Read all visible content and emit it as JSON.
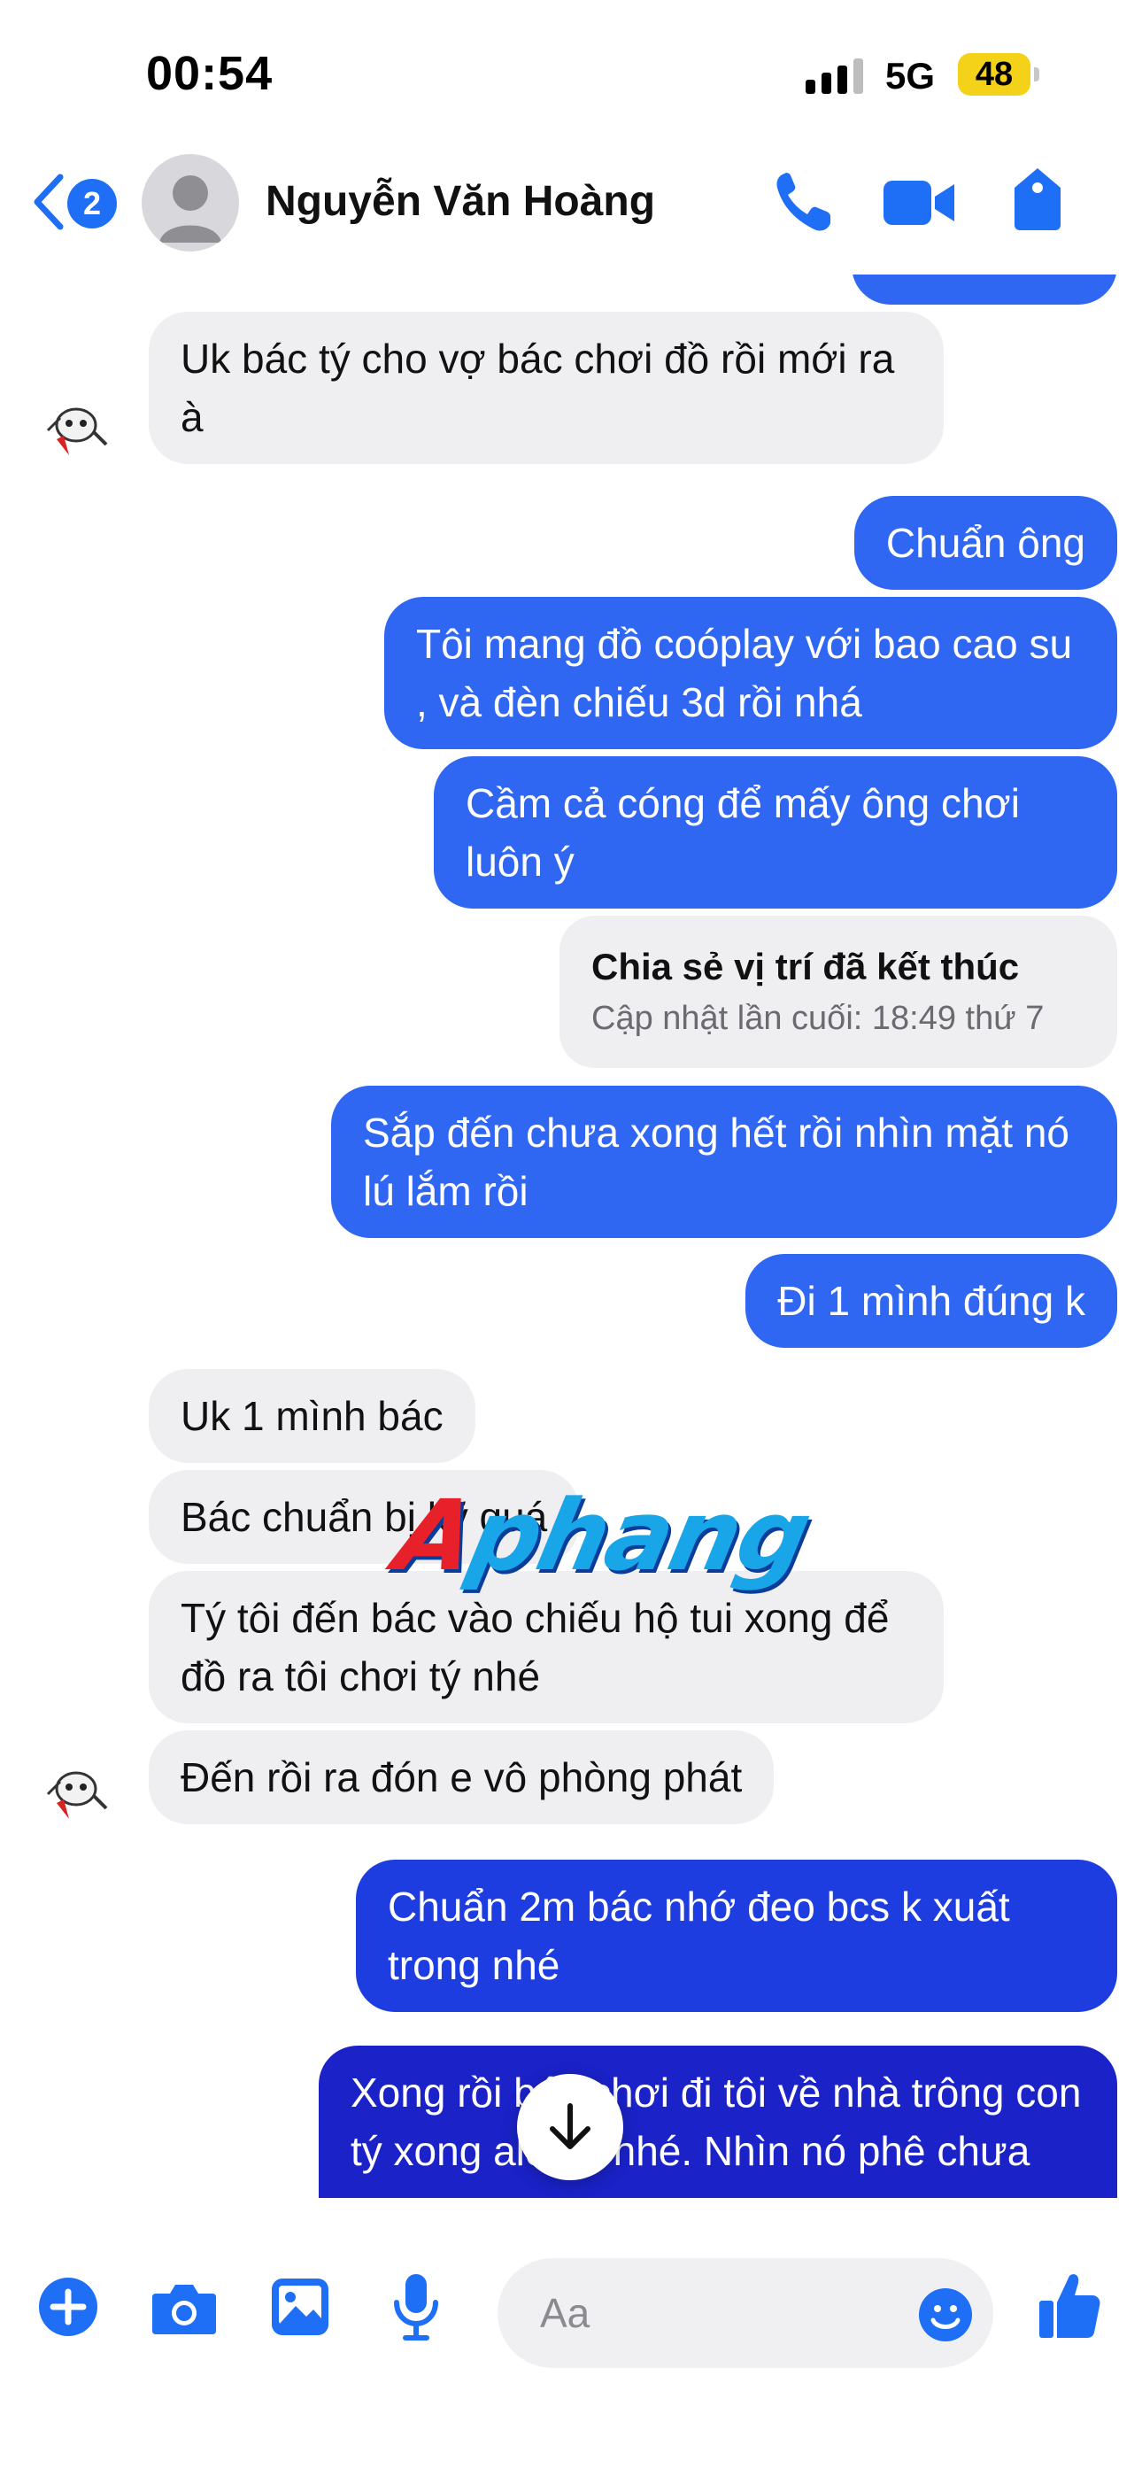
{
  "status_bar": {
    "time": "00:54",
    "network": "5G",
    "battery": "48"
  },
  "header": {
    "back_badge": "2",
    "contact_name": "Nguyễn Văn Hoàng"
  },
  "messages": [
    {
      "dir": "in",
      "text": "Uk bác tý cho vợ bác chơi đồ rồi mới ra à"
    },
    {
      "dir": "out",
      "text": "Chuẩn ông"
    },
    {
      "dir": "out",
      "text": "Tôi mang đồ coóplay với bao cao su , và đèn chiếu 3d rồi nhá"
    },
    {
      "dir": "out",
      "text": "Cầm cả cóng để mấy ông chơi luôn ý"
    },
    {
      "dir": "out",
      "type": "location",
      "title": "Chia sẻ vị trí đã kết thúc",
      "subtitle": "Cập nhật lần cuối: 18:49 thứ 7"
    },
    {
      "dir": "out",
      "text": "Sắp đến chưa xong hết rồi nhìn mặt nó lú lắm rồi"
    },
    {
      "dir": "out",
      "text": "Đi 1 mình đúng k"
    },
    {
      "dir": "in",
      "text": "Uk 1 mình bác"
    },
    {
      "dir": "in",
      "text": "Bác chuẩn bị kỹ quá"
    },
    {
      "dir": "in",
      "text": "Tý tôi đến bác vào chiếu hộ tui xong để đồ ra tôi chơi tý nhé"
    },
    {
      "dir": "in",
      "text": "Đến rồi ra đón e vô phòng phát"
    },
    {
      "dir": "out",
      "text": "Chuẩn 2m bác nhớ đeo bcs k xuất trong nhé"
    },
    {
      "dir": "out",
      "text": "Xong rồi bác chơi đi tôi về nhà trông con tý xong alo tôi nhé. Nhìn nó phê chưa"
    }
  ],
  "watermark": {
    "first": "A",
    "rest": "phang"
  },
  "composer": {
    "placeholder": "Aa"
  },
  "icons": {
    "back": "chevron-left-icon",
    "call": "phone-icon",
    "video": "video-camera-icon",
    "tag": "tag-icon",
    "plus": "plus-circle-icon",
    "camera": "camera-icon",
    "gallery": "image-icon",
    "mic": "microphone-icon",
    "emoji": "emoji-icon",
    "like": "thumbs-up-icon",
    "scroll": "arrow-down-icon"
  },
  "colors": {
    "accent": "#1e6ff5",
    "outgoing_bubble": "#2f67f3",
    "incoming_bubble": "#efeff2",
    "battery": "#f5d21a"
  }
}
